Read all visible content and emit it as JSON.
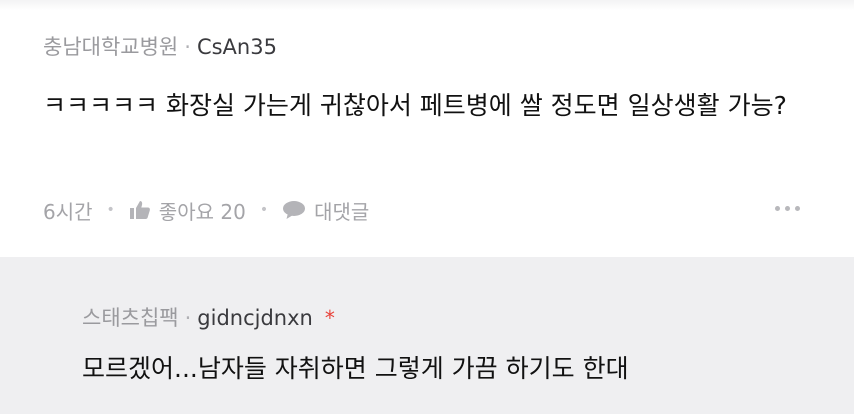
{
  "comment": {
    "affiliation": "충남대학교병원",
    "separator": "·",
    "username": "CsAn35",
    "text": "ㅋㅋㅋㅋㅋ 화장실 가는게 귀찮아서 페트병에 쌀 정도면 일상생활 가능?",
    "time": "6시간",
    "like_label": "좋아요 20",
    "reply_label": "대댓글",
    "icons": {
      "like": "thumbs-up-icon",
      "reply": "speech-bubble-icon",
      "more": "more-dots-icon"
    }
  },
  "reply": {
    "affiliation": "스태츠칩팩",
    "separator": "·",
    "username": "gidncjdnxn",
    "author_mark": "*",
    "text": "모르겠어...남자들 자취하면 그렇게 가끔 하기도 한대"
  },
  "colors": {
    "reply_background": "#efeff1",
    "author_mark": "#e8423a",
    "meta_text": "#9a9a9e"
  }
}
